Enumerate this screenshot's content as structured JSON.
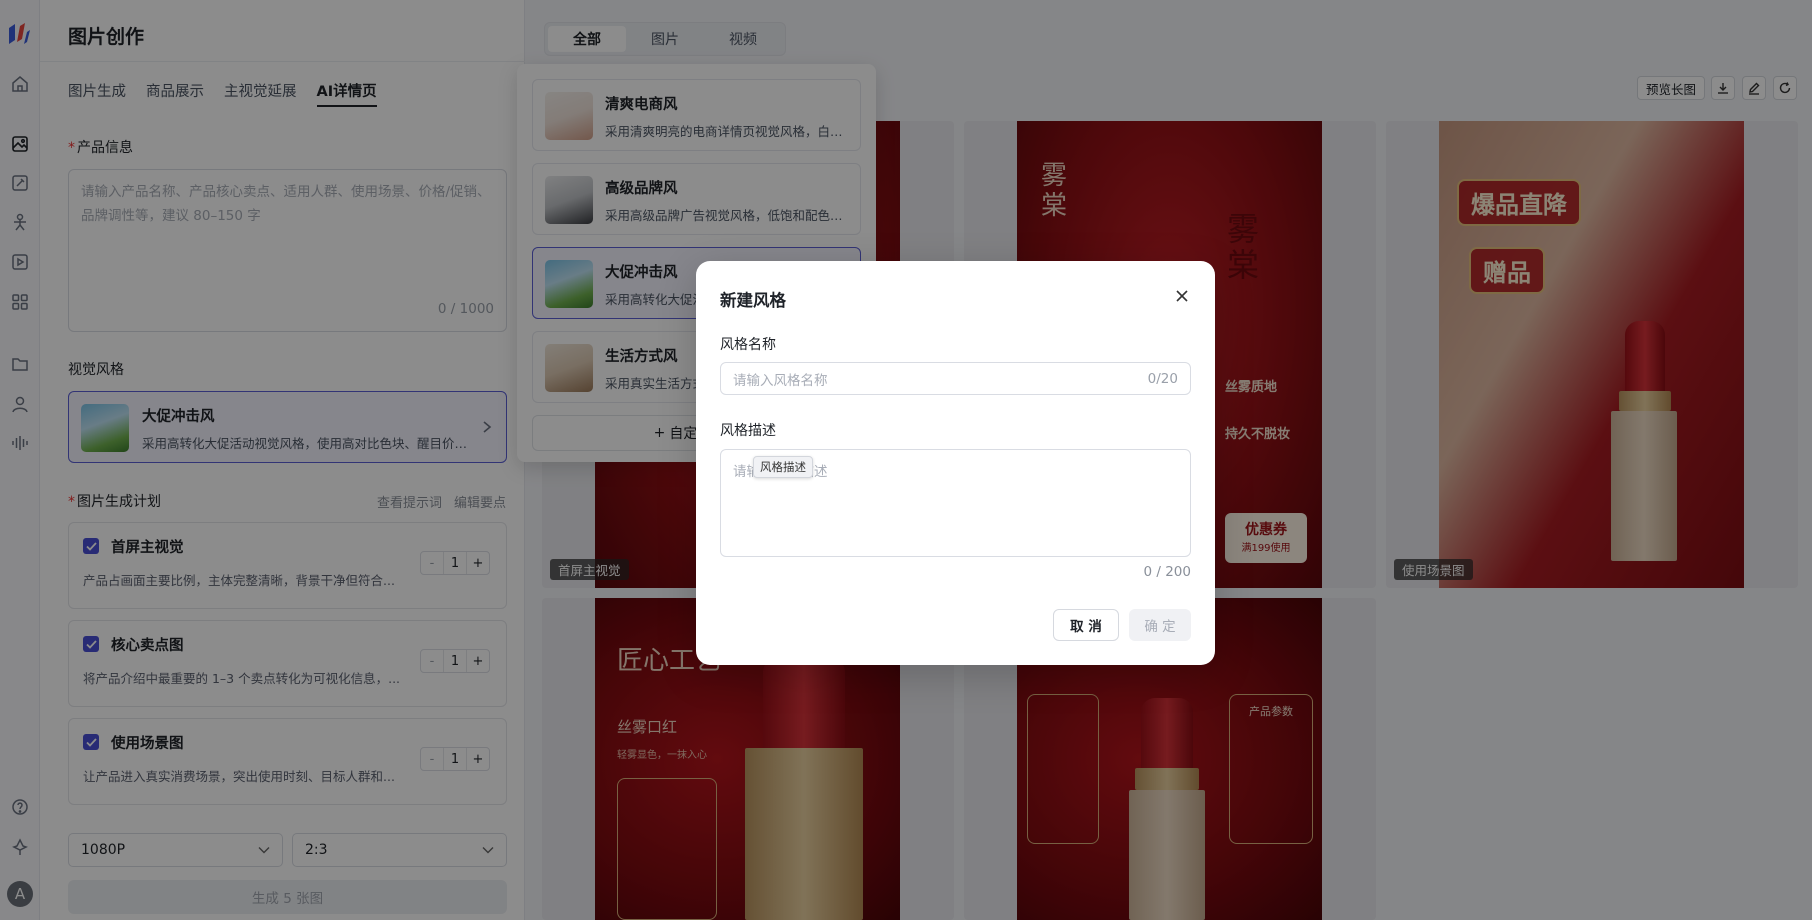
{
  "app": {
    "title": "图片创作",
    "avatar_letter": "A"
  },
  "subtabs": [
    {
      "label": "图片生成",
      "active": false
    },
    {
      "label": "商品展示",
      "active": false
    },
    {
      "label": "主视觉延展",
      "active": false
    },
    {
      "label": "AI详情页",
      "active": true
    }
  ],
  "product": {
    "label": "产品信息",
    "placeholder": "请输入产品名称、产品核心卖点、适用人群、使用场景、价格/促销、品牌调性等，建议 80–150 字",
    "count": "0 / 1000"
  },
  "visual_style": {
    "label": "视觉风格",
    "name": "大促冲击风",
    "desc": "采用高转化大促活动视觉风格，使用高对比色块、醒目价格..."
  },
  "plan": {
    "label": "图片生成计划",
    "view_prompt": "查看提示词",
    "edit_points": "编辑要点",
    "items": [
      {
        "title": "首屏主视觉",
        "desc": "产品占画面主要比例，主体完整清晰，背景干净但符合...",
        "qty": "1"
      },
      {
        "title": "核心卖点图",
        "desc": "将产品介绍中最重要的 1–3 个卖点转化为可视化信息，...",
        "qty": "1"
      },
      {
        "title": "使用场景图",
        "desc": "让产品进入真实消费场景，突出使用时刻、目标人群和...",
        "qty": "1"
      }
    ],
    "minus": "-",
    "plus": "+"
  },
  "settings": {
    "resolution": "1080P",
    "ratio": "2:3"
  },
  "generate_label": "生成 5 张图",
  "main_tabs": [
    {
      "label": "全部",
      "active": true
    },
    {
      "label": "图片",
      "active": false
    },
    {
      "label": "视频",
      "active": false
    }
  ],
  "toolbar": {
    "preview_label": "预览长图"
  },
  "gallery": {
    "labels": [
      "首屏主视觉",
      "使用场景图"
    ],
    "texts": {
      "brand": "雾棠",
      "brand_v": "雾\n棠",
      "badge1": "爆品直降",
      "badge2": "赠品",
      "craft": "匠心工艺",
      "sub1": "丝雾口红",
      "sub2": "轻雾显色，一抹入心",
      "p1": "丝雾质地",
      "p2": "持久不脱妆",
      "coupon": "优惠券",
      "coupon_sub": "满199使用",
      "params": "产品参数"
    }
  },
  "dropdown": {
    "items": [
      {
        "name": "清爽电商风",
        "desc": "采用清爽明亮的电商详情页视觉风格，白色...",
        "selected": false
      },
      {
        "name": "高级品牌风",
        "desc": "采用高级品牌广告视觉风格，低饱和配色，...",
        "selected": false
      },
      {
        "name": "大促冲击风",
        "desc": "采用高转化大促活动视觉风格",
        "selected": true
      },
      {
        "name": "生活方式风",
        "desc": "采用真实生活方式场景视觉风格",
        "selected": false
      }
    ],
    "add_label": "自定义风格"
  },
  "modal": {
    "title": "新建风格",
    "name_label": "风格名称",
    "name_placeholder": "请输入风格名称",
    "name_count": "0/20",
    "desc_label": "风格描述",
    "desc_placeholder": "请输入风格描述",
    "desc_tooltip": "风格描述",
    "desc_count": "0 / 200",
    "cancel": "取 消",
    "ok": "确 定"
  },
  "colors": {
    "accent": "#5b5fd6",
    "checkbox": "#4a4fd6",
    "overlay": "rgba(0,0,0,0.45)"
  }
}
